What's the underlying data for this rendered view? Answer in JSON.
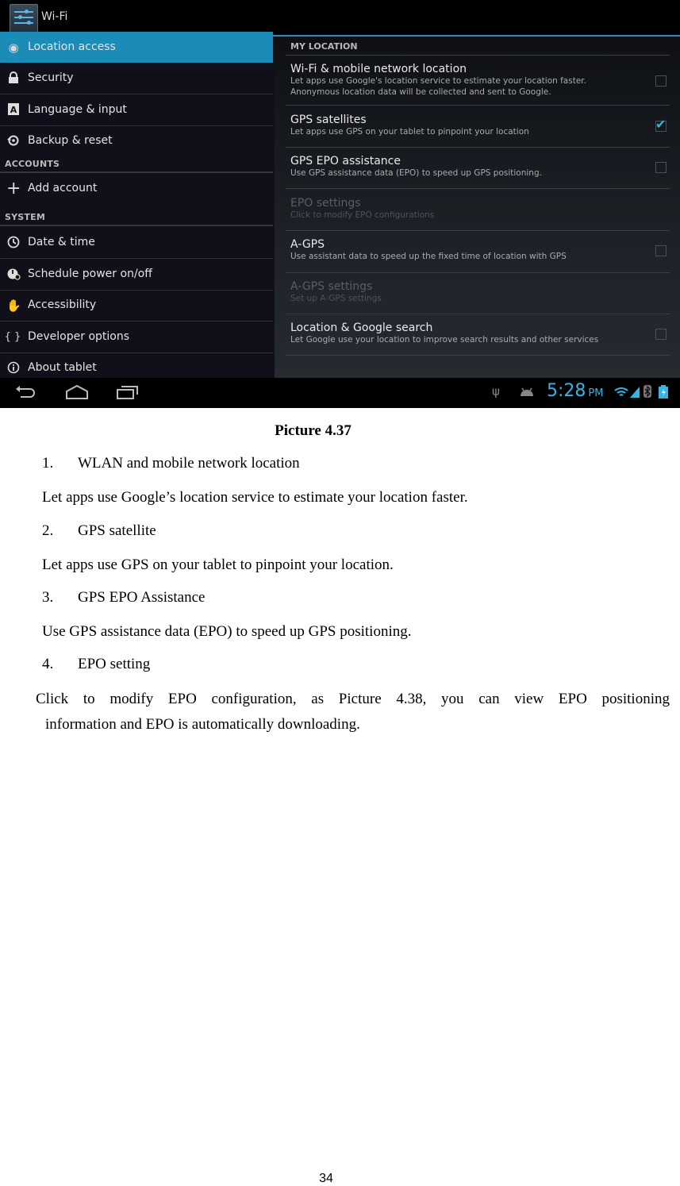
{
  "screenshot": {
    "action_bar": {
      "title": "Wi-Fi",
      "icon": "settings-sliders-icon"
    },
    "sidebar": {
      "items": [
        {
          "label": "Location access",
          "icon": "location-icon",
          "active": true
        },
        {
          "label": "Security",
          "icon": "lock-icon"
        },
        {
          "label": "Language & input",
          "icon": "keyboard-a-icon"
        },
        {
          "label": "Backup & reset",
          "icon": "backup-icon"
        }
      ],
      "accounts_header": "ACCOUNTS",
      "accounts_items": [
        {
          "label": "Add account",
          "icon": "plus-icon"
        }
      ],
      "system_header": "SYSTEM",
      "system_items": [
        {
          "label": "Date & time",
          "icon": "clock-icon"
        },
        {
          "label": "Schedule power on/off",
          "icon": "power-clock-icon"
        },
        {
          "label": "Accessibility",
          "icon": "hand-icon"
        },
        {
          "label": "Developer options",
          "icon": "braces-icon",
          "glyph": "{ }"
        },
        {
          "label": "About tablet",
          "icon": "info-icon"
        }
      ]
    },
    "content": {
      "header": "MY LOCATION",
      "items": [
        {
          "title": "Wi-Fi & mobile network location",
          "summary": "Let apps use Google's location service to estimate your location faster.",
          "summary2": "Anonymous location data will be collected and sent to Google.",
          "checked": false,
          "enabled": true
        },
        {
          "title": "GPS satellites",
          "summary": "Let apps use GPS on your tablet to pinpoint your location",
          "checked": true,
          "enabled": true
        },
        {
          "title": "GPS EPO assistance",
          "summary": "Use GPS assistance data (EPO) to speed up GPS positioning.",
          "checked": false,
          "enabled": true
        },
        {
          "title": "EPO settings",
          "summary": "Click to modify EPO configurations",
          "enabled": false
        },
        {
          "title": "A-GPS",
          "summary": "Use assistant data to speed up the fixed time of location with GPS",
          "checked": false,
          "enabled": true
        },
        {
          "title": "A-GPS settings",
          "summary": "Set up A-GPS settings",
          "enabled": false
        },
        {
          "title": "Location & Google search",
          "summary": "Let Google use your location to improve search results and other services",
          "checked": false,
          "enabled": true
        }
      ]
    },
    "nav_bar": {
      "back": "back-icon",
      "home": "home-icon",
      "recents": "recents-icon",
      "time": "5:28",
      "ampm": "PM",
      "status_icons": [
        "usb-icon",
        "android-debug-icon",
        "wifi-icon",
        "signal-icon",
        "bluetooth-icon",
        "battery-icon"
      ],
      "accent": "#33b5e5"
    }
  },
  "document": {
    "caption": "Picture 4.37",
    "sections": [
      {
        "num": "1.",
        "heading": "WLAN and mobile network location",
        "body": "Let apps use Google’s location service to estimate your location faster."
      },
      {
        "num": "2.",
        "heading": "GPS satellite",
        "body": "Let apps use GPS on your tablet to pinpoint your location."
      },
      {
        "num": "3.",
        "heading": "GPS EPO Assistance",
        "body": "Use GPS assistance data (EPO) to speed up GPS positioning."
      },
      {
        "num": "4.",
        "heading": "EPO setting",
        "body_line1": "Click to modify EPO configuration, as Picture 4.38, you can view EPO positioning",
        "body_line2": "information and EPO is automatically downloading."
      }
    ],
    "page_number": "34"
  }
}
